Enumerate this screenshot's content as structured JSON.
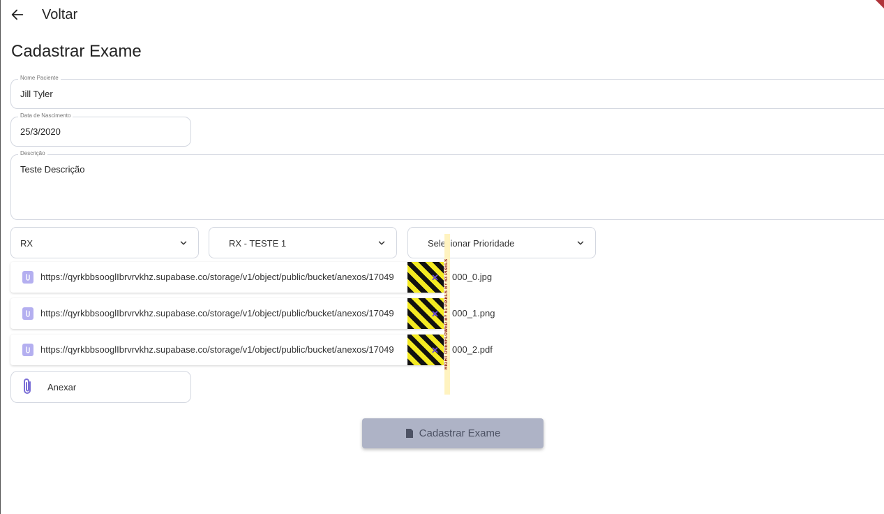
{
  "header": {
    "back_label": "Voltar"
  },
  "page": {
    "title": "Cadastrar Exame"
  },
  "form": {
    "patient_name": {
      "label": "Nome Paciente",
      "value": "Jill Tyler"
    },
    "birth_date": {
      "label": "Data de Nascimento",
      "value": "25/3/2020"
    },
    "description": {
      "label": "Descrição",
      "value": "Teste Descrição"
    },
    "selects": [
      {
        "value": "RX"
      },
      {
        "value": "RX - TESTE 1"
      },
      {
        "value": "Selecionar Prioridade"
      }
    ]
  },
  "attachments": [
    {
      "url": "https://qyrkbbsooglIbrvrvkhz.supabase.co/storage/v1/object/public/bucket/anexos/17049",
      "suffix": "000_0.jpg"
    },
    {
      "url": "https://qyrkbbsooglIbrvrvkhz.supabase.co/storage/v1/object/public/bucket/anexos/17049",
      "suffix": "000_1.png"
    },
    {
      "url": "https://qyrkbbsooglIbrvrvkhz.supabase.co/storage/v1/object/public/bucket/anexos/17049",
      "suffix": "000_2.pdf"
    }
  ],
  "overflow_warning": "RIGHT OVERFLOWED BY 61 PIXELS BY 63 PIXELS",
  "attach_button": {
    "label": "Anexar"
  },
  "submit_button": {
    "label": "Cadastrar Exame"
  },
  "colors": {
    "accent": "#7b6fd6",
    "border": "#d3d7e0",
    "submit_bg": "#aeb3c6",
    "overflow_stripe_yellow": "#f4ea22",
    "overflow_stripe_black": "#111111"
  },
  "icons": {
    "back": "arrow-left-icon",
    "chevron": "chevron-down-icon",
    "attachment": "paperclip-icon",
    "remove": "close-icon",
    "submit": "file-icon"
  }
}
